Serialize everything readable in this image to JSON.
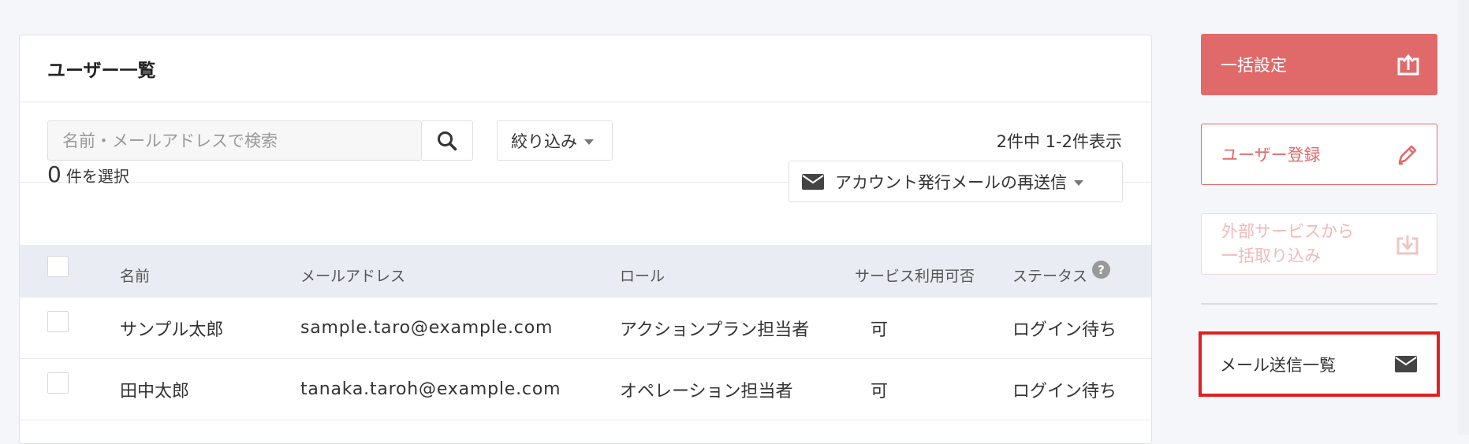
{
  "panel": {
    "title": "ユーザー一覧",
    "search_placeholder": "名前・メールアドレスで検索",
    "filter_label": "絞り込み",
    "count_text": "2件中 1-2件表示",
    "selected_count": "0",
    "selected_suffix": "件を選択",
    "resend_label": "アカウント発行メールの再送信"
  },
  "table": {
    "headers": {
      "name": "名前",
      "email": "メールアドレス",
      "role": "ロール",
      "service": "サービス利用可否",
      "status": "ステータス",
      "status_help": "?"
    },
    "rows": [
      {
        "name": "サンプル太郎",
        "email": "sample.taro@example.com",
        "role": "アクションプラン担当者",
        "service": "可",
        "status": "ログイン待ち"
      },
      {
        "name": "田中太郎",
        "email": "tanaka.taroh@example.com",
        "role": "オペレーション担当者",
        "service": "可",
        "status": "ログイン待ち"
      }
    ]
  },
  "sidebar": {
    "bulk_setting": "一括設定",
    "user_register": "ユーザー登録",
    "external_import_line1": "外部サービスから",
    "external_import_line2": "一括取り込み",
    "mail_list": "メール送信一覧"
  },
  "colors": {
    "accent": "#e06a6a",
    "highlight_border": "#e02020",
    "table_header_bg": "#e9edf3"
  },
  "icons": [
    "search-icon",
    "chevron-down-icon",
    "envelope-icon",
    "upload-icon",
    "pencil-icon",
    "download-icon",
    "help-icon"
  ]
}
